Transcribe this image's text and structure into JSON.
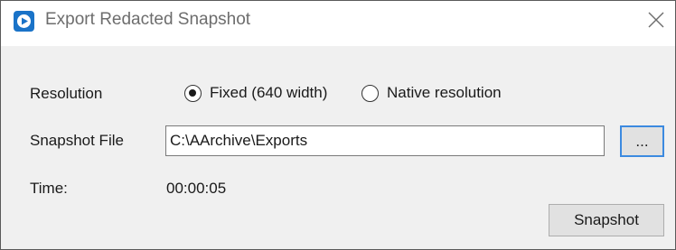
{
  "window": {
    "title": "Export Redacted Snapshot",
    "app_icon": "play-logo-icon",
    "close_icon": "close-icon"
  },
  "form": {
    "resolution_label": "Resolution",
    "resolution_options": [
      {
        "label": "Fixed (640 width)",
        "selected": true
      },
      {
        "label": "Native resolution",
        "selected": false
      }
    ],
    "snapshot_file_label": "Snapshot File",
    "snapshot_file_value": "C:\\AArchive\\Exports",
    "browse_label": "...",
    "time_label": "Time:",
    "time_value": "00:00:05"
  },
  "buttons": {
    "snapshot_label": "Snapshot"
  },
  "colors": {
    "accent": "#3c8ae0",
    "app_icon": "#1a73c8",
    "window_bg": "#f0f0f0"
  }
}
